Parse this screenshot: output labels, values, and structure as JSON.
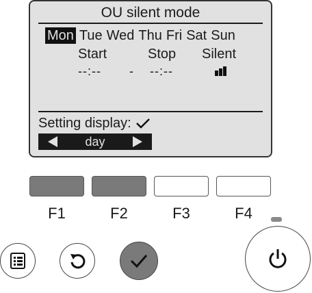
{
  "screen": {
    "title": "OU silent mode",
    "days": [
      "Mon",
      "Tue",
      "Wed",
      "Thu",
      "Fri",
      "Sat",
      "Sun"
    ],
    "selected_day": "Mon",
    "start_label": "Start",
    "stop_label": "Stop",
    "silent_label": "Silent",
    "start_value": "--:--",
    "separator": "-",
    "stop_value": "--:--",
    "silent_level_icon": "silent-level-icon",
    "setting_display_label": "Setting display:",
    "setting_display_icon": "checkmark-icon",
    "day_selector_label": "day"
  },
  "function_keys": [
    {
      "label": "F1",
      "state": "pressed"
    },
    {
      "label": "F2",
      "state": "pressed"
    },
    {
      "label": "F3",
      "state": "normal"
    },
    {
      "label": "F4",
      "state": "normal"
    }
  ],
  "buttons": {
    "menu_icon": "menu-icon",
    "return_icon": "return-icon",
    "select_icon": "checkmark-icon",
    "power_icon": "power-icon"
  },
  "colors": {
    "lcd_background": "#e1e1e1",
    "pressed_key": "#7a7a7a",
    "select_button": "#7a7a7a",
    "led": "#8a8a8a"
  }
}
